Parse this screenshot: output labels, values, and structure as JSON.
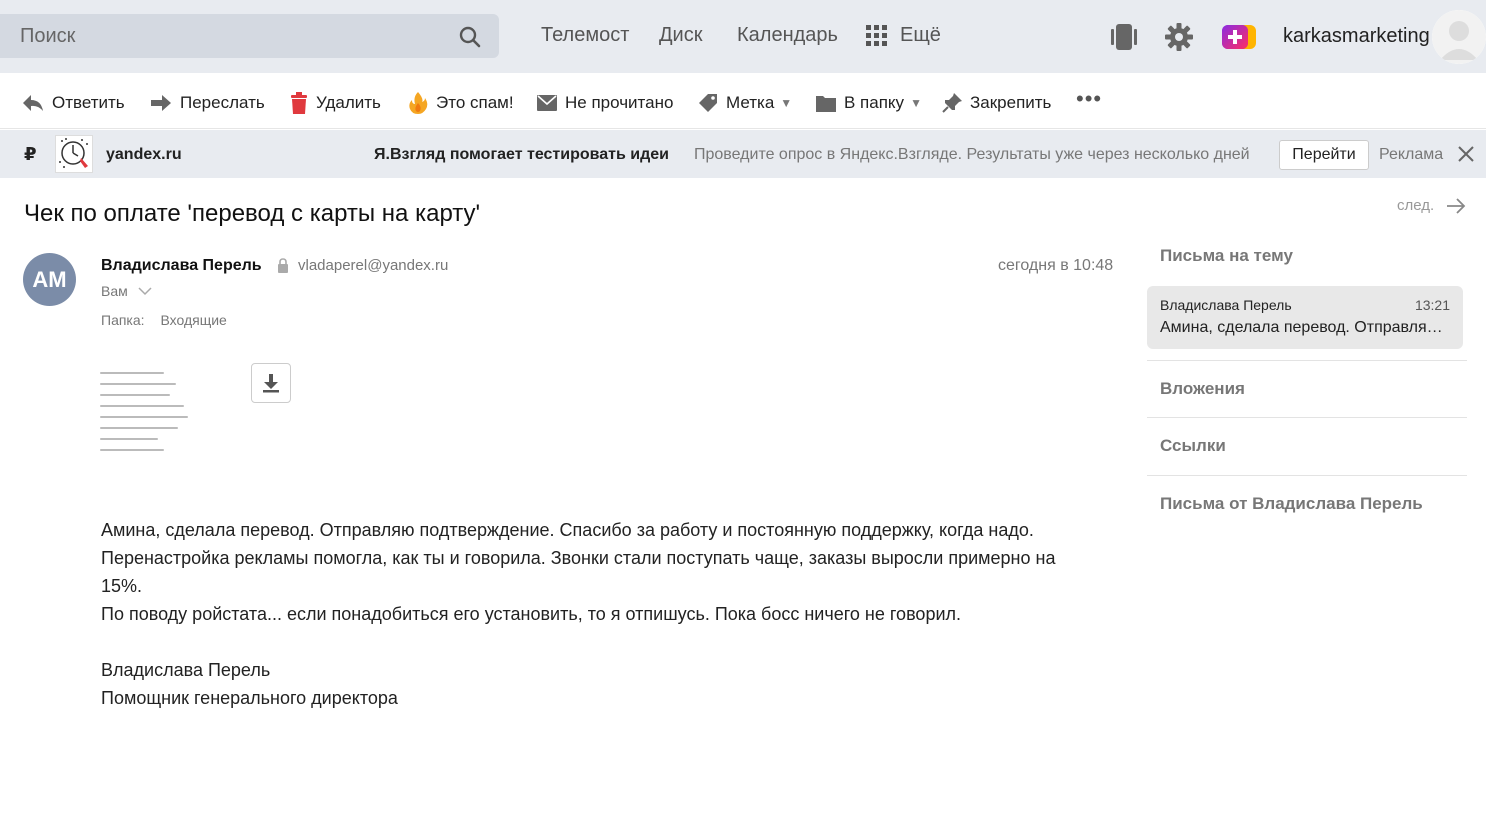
{
  "header": {
    "search_placeholder": "Поиск",
    "nav": [
      "Телемост",
      "Диск",
      "Календарь"
    ],
    "more_label": "Ещё",
    "username": "karkasmarketing"
  },
  "toolbar": {
    "reply": "Ответить",
    "forward": "Переслать",
    "delete": "Удалить",
    "spam": "Это спам!",
    "unread": "Не прочитано",
    "label": "Метка",
    "folder": "В папку",
    "pin": "Закрепить"
  },
  "ad": {
    "currency": "₽",
    "domain": "yandex.ru",
    "title": "Я.Взгляд помогает тестировать идеи",
    "text": "Проведите опрос в Яндекс.Взгляде. Результаты уже через несколько дней",
    "button": "Перейти",
    "label": "Реклама"
  },
  "message": {
    "subject": "Чек по оплате 'перевод с карты на карту'",
    "next_label": "след.",
    "avatar_initials": "АМ",
    "sender_name": "Владислава Перель",
    "sender_email": "vladaperel@yandex.ru",
    "date": "сегодня в 10:48",
    "to": "Вам",
    "folder_label": "Папка:",
    "folder_value": "Входящие",
    "body": [
      "Амина, сделала перевод. Отправляю подтверждение. Спасибо за работу и постоянную поддержку, когда надо.",
      "Перенастройка рекламы помогла, как ты и говорила. Звонки стали поступать чаще, заказы выросли примерно на 15%.",
      "По поводу ройстата... если понадобиться его установить, то я отпишусь. Пока босс ничего не говорил."
    ],
    "signature_name": "Владислава Перель",
    "signature_title": "Помощник генерального директора"
  },
  "sidebar": {
    "thread_title": "Письма на тему",
    "thread_item": {
      "sender": "Владислава Перель",
      "time": "13:21",
      "preview": "Амина, сделала перевод. Отправляю подтверждение. Спасибо за работу"
    },
    "attachments": "Вложения",
    "links": "Ссылки",
    "from_sender": "Письма от Владислава Перель"
  },
  "colors": {
    "header_bg": "#e8ebf0",
    "search_bg": "#d4d9e1",
    "avatar_bg": "#7b8ca8",
    "delete_red": "#e0393e",
    "spam_orange": "#f5a623"
  }
}
